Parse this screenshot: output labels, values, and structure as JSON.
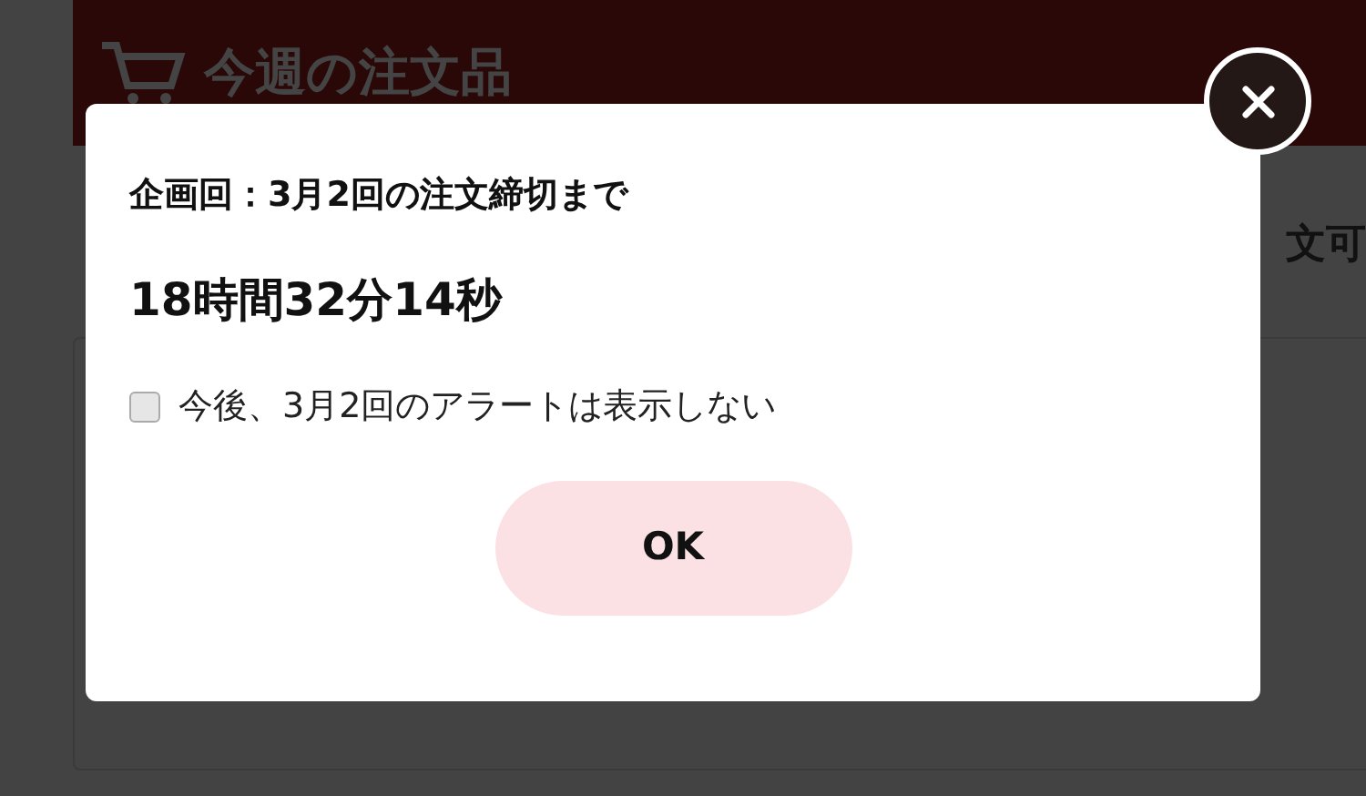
{
  "page": {
    "header_title": "今週の注文品",
    "background_text": "文可"
  },
  "dialog": {
    "heading": "企画回：3月2回の注文締切まで",
    "countdown": "18時間32分14秒",
    "checkbox": {
      "label": "今後、3月2回のアラートは表示しない",
      "checked": false
    },
    "ok_button": "OK"
  }
}
